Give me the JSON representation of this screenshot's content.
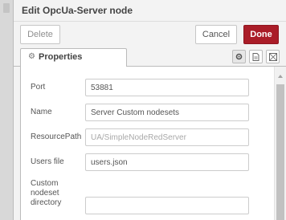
{
  "dialog": {
    "title": "Edit OpcUa-Server node"
  },
  "toolbar": {
    "delete_label": "Delete",
    "cancel_label": "Cancel",
    "done_label": "Done"
  },
  "tabs": {
    "properties_label": "Properties",
    "icons": [
      "gear-icon",
      "description-icon",
      "appearance-icon"
    ]
  },
  "form": {
    "port": {
      "label": "Port",
      "value": "53881"
    },
    "name": {
      "label": "Name",
      "value": "Server Custom nodesets"
    },
    "resource_path": {
      "label": "ResourcePath",
      "value": "UA/SimpleNodeRedServer"
    },
    "users_file": {
      "label": "Users file",
      "value": "users.json"
    },
    "custom_nodeset_directory": {
      "label_line1": "Custom",
      "label_line2": "nodeset",
      "label_line3": "directory",
      "value": ""
    }
  },
  "colors": {
    "done_button": "#aa1d28",
    "panel_background": "#ffffff",
    "tray_background": "#f3f3f3"
  }
}
